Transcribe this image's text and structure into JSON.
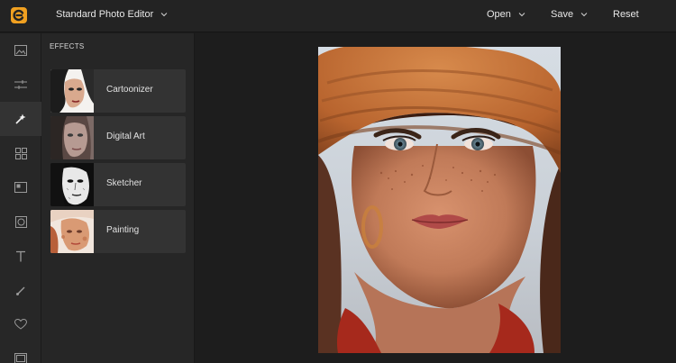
{
  "app": {
    "logo_icon": "app-logo-icon",
    "mode_label": "Standard Photo Editor",
    "accent": "#f0a020"
  },
  "topnav": {
    "open_label": "Open",
    "save_label": "Save",
    "reset_label": "Reset"
  },
  "rail": {
    "icons": [
      "image-icon",
      "sliders-icon",
      "magic-wand-icon",
      "grid-icon",
      "frame-icon",
      "vignette-icon",
      "text-icon",
      "brush-icon",
      "heart-icon",
      "border-icon"
    ],
    "active": "magic-wand-icon"
  },
  "effects": {
    "title": "EFFECTS",
    "items": [
      {
        "label": "Cartoonizer"
      },
      {
        "label": "Digital Art"
      },
      {
        "label": "Sketcher"
      },
      {
        "label": "Painting"
      }
    ]
  }
}
